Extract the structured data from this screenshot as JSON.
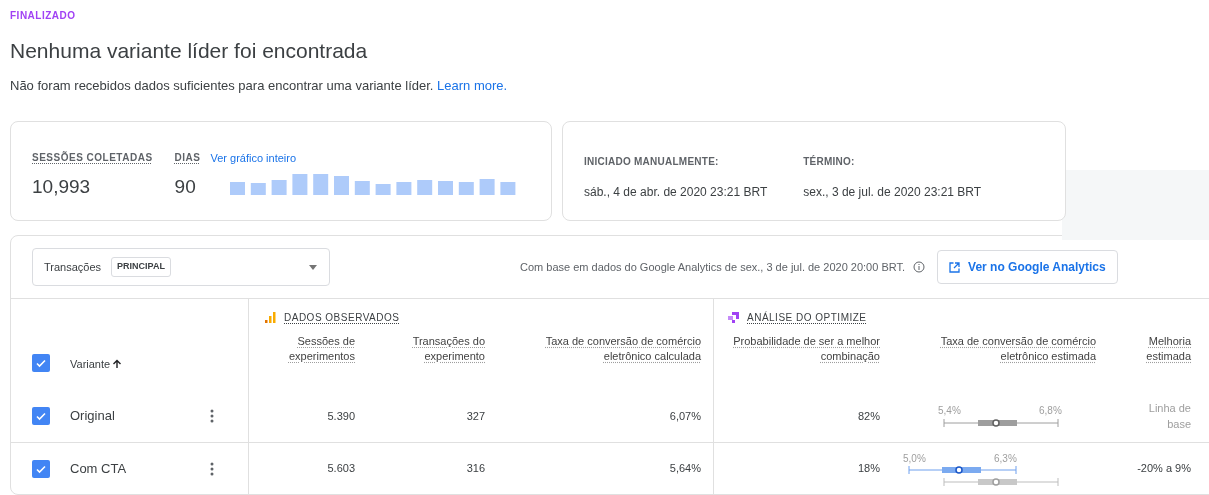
{
  "status": "FINALIZADO",
  "heading": "Nenhuma variante líder foi encontrada",
  "description": "Não foram recebidos dados suficientes para encontrar uma variante líder.",
  "learn_more": "Learn more.",
  "summary": {
    "sessions_label": "SESSÕES COLETADAS",
    "sessions_value": "10,993",
    "days_label": "DIAS",
    "days_value": "90",
    "chart_link": "Ver gráfico inteiro"
  },
  "dates": [
    {
      "label": "INICIADO MANUALMENTE:",
      "value": "sáb., 4 de abr. de 2020 23:21 BRT"
    },
    {
      "label": "TÉRMINO:",
      "value": "sex., 3 de jul. de 2020 23:21 BRT"
    }
  ],
  "objective": {
    "label": "Transações",
    "tag": "PRINCIPAL"
  },
  "source_note": "Com base em dados do Google Analytics de sex., 3 de jul. de 2020 20:00 BRT.",
  "analytics_button": "Ver no Google Analytics",
  "groups": [
    {
      "title": "DADOS OBSERVADOS"
    },
    {
      "title": "ANÁLISE DO OPTIMIZE"
    }
  ],
  "header_checked": true,
  "variant_column": "Variante",
  "columns": [
    "Sessões de experimentos",
    "Transações do experimento",
    "Taxa de conversão de comércio eletrônico calculada",
    "Probabilidade de ser a melhor combinação",
    "Taxa de conversão de comércio eletrônico estimada",
    "Melhoria estimada"
  ],
  "rows": [
    {
      "name": "Original",
      "checked": true,
      "sessions": "5.390",
      "transactions": "327",
      "rate": "6,07%",
      "probability": "82%",
      "low": "5,4%",
      "high": "6,8%",
      "kind": "baseline",
      "improvement": "Linha de base"
    },
    {
      "name": "Com CTA",
      "checked": true,
      "sessions": "5.603",
      "transactions": "316",
      "rate": "5,64%",
      "probability": "18%",
      "low": "5,0%",
      "high": "6,3%",
      "kind": "variant",
      "improvement": "-20% a 9%"
    }
  ]
}
